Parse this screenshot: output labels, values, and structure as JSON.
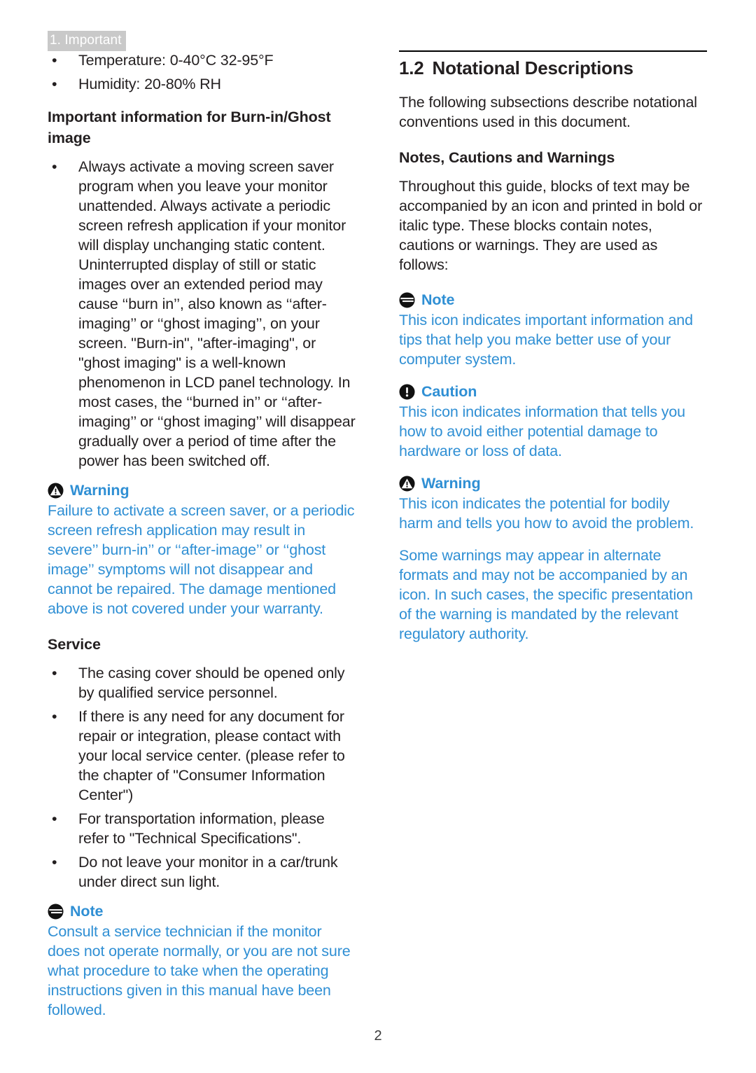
{
  "meta": {
    "running_header": "1. Important",
    "page_number": "2",
    "accent_blue": "#2f8fd4",
    "header_badge_bg": "#c9c9c9",
    "header_badge_text_color": "#ffffff",
    "body_text_color": "#231f20"
  },
  "left_column": {
    "spec_bullets": [
      "Temperature: 0-40°C 32-95°F",
      "Humidity: 20-80% RH"
    ],
    "burnin_heading": "Important information for Burn-in/Ghost image",
    "burnin_bullets": [
      "Always activate a moving screen saver program when you leave your monitor unattended. Always activate a periodic screen refresh application if your monitor will display unchanging static content. Uninterrupted display of still or static images over an extended period may cause ‘‘burn in’’, also known as ‘‘after-imaging’’ or ‘‘ghost imaging’’, on your screen. \"Burn-in\", \"after-imaging\", or \"ghost imaging\" is a well-known phenomenon in LCD panel technology. In most cases, the ‘‘burned in’’ or ‘‘after-imaging’’ or ‘‘ghost imaging’’ will disappear gradually over a period of time after the power has been switched off."
    ],
    "warning_callout": {
      "icon": "warning-triangle-icon",
      "label": "Warning",
      "body": "Failure to activate a screen saver, or a periodic screen refresh application may result in severe’’ burn-in’’ or ‘‘after-image’’ or ‘‘ghost image’’ symptoms will not disappear and cannot be repaired. The damage mentioned above is not covered under your warranty."
    },
    "service_heading": "Service",
    "service_bullets": [
      "The casing cover should be opened only by qualified service personnel.",
      "If there is any need for any document for repair or integration, please contact with your local service center. (please refer to the chapter of \"Consumer Information Center\")",
      "For transportation information, please refer to \"Technical Specifications\".",
      "Do not leave your monitor in a car/trunk under direct sun light."
    ],
    "note_callout": {
      "icon": "note-lines-icon",
      "label": "Note",
      "body": "Consult a service technician if the monitor does not operate normally, or you are not sure what procedure to take when the operating instructions given in this manual have been followed."
    }
  },
  "right_column": {
    "section": {
      "number": "1.2",
      "title": "Notational Descriptions"
    },
    "intro": "The following subsections describe notational conventions used in this document.",
    "subheading": "Notes, Cautions and Warnings",
    "subheading_body": "Throughout this guide, blocks of text may be accompanied by an icon and printed in bold or italic type. These blocks contain notes, cautions or warnings. They are used as follows:",
    "note_callout": {
      "icon": "note-lines-icon",
      "label": "Note",
      "body": "This icon indicates important information and tips that help you make better use of your computer system."
    },
    "caution_callout": {
      "icon": "caution-exclamation-icon",
      "label": "Caution",
      "body": "This icon indicates information that tells you how to avoid either potential damage to hardware or loss of data."
    },
    "warning_callout": {
      "icon": "warning-triangle-icon",
      "label": "Warning",
      "body": "This icon indicates the potential for bodily harm and tells you how to avoid the problem."
    },
    "closing_note": "Some warnings may appear in alternate formats and may not be accompanied by an icon. In such cases, the specific presentation of the warning is mandated by the relevant regulatory authority."
  }
}
